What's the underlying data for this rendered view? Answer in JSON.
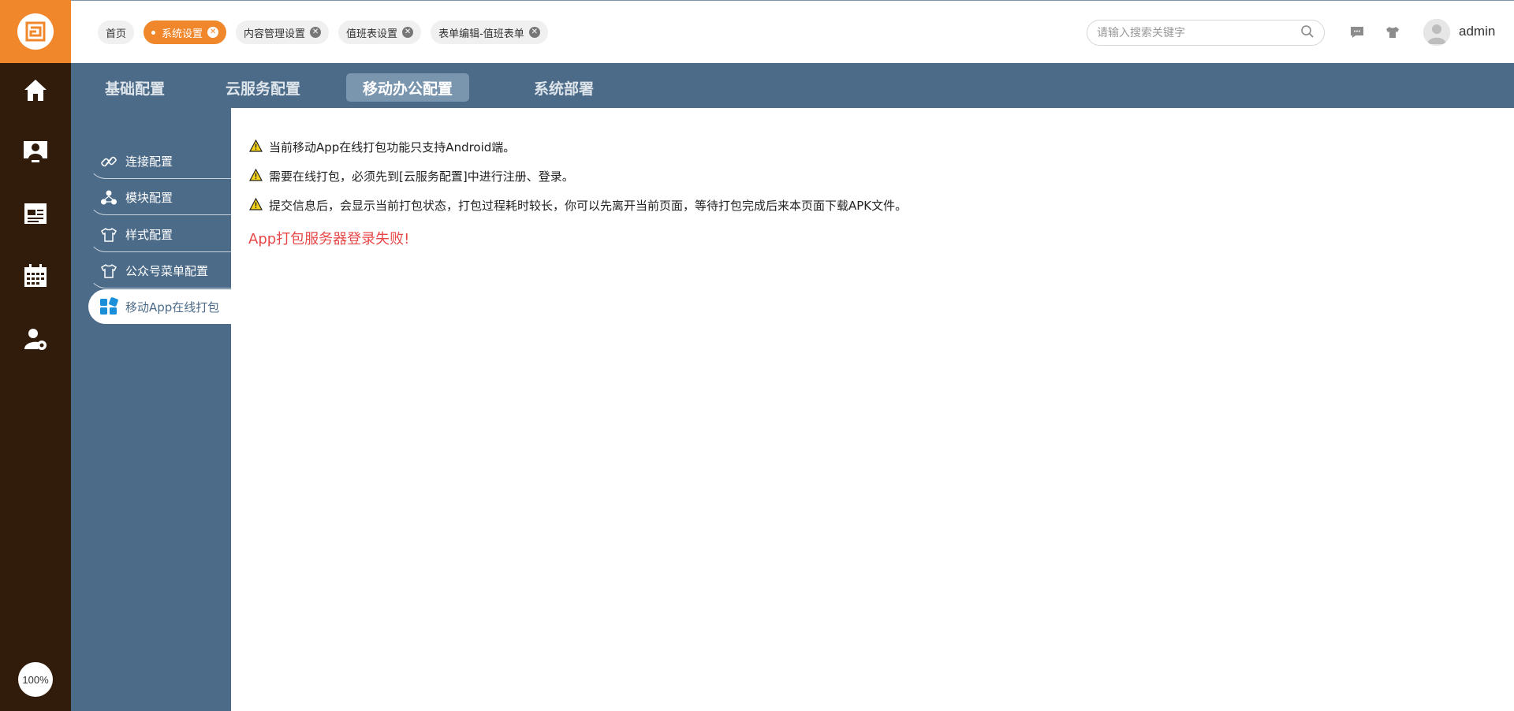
{
  "rail": {
    "icons": [
      "home-icon",
      "user-monitor-icon",
      "newspaper-icon",
      "calendar-icon",
      "user-settings-icon"
    ],
    "zoom": "100%"
  },
  "tags": [
    {
      "label": "首页",
      "closable": false,
      "active": false
    },
    {
      "label": "系统设置",
      "closable": true,
      "active": true
    },
    {
      "label": "内容管理设置",
      "closable": true,
      "active": false
    },
    {
      "label": "值班表设置",
      "closable": true,
      "active": false
    },
    {
      "label": "表单编辑-值班表单",
      "closable": true,
      "active": false
    }
  ],
  "search": {
    "placeholder": "请输入搜索关键字"
  },
  "user": {
    "name": "admin"
  },
  "subnav": {
    "tabs": [
      "基础配置",
      "云服务配置",
      "移动办公配置",
      "系统部署"
    ],
    "active_index": 2
  },
  "sidemenu": {
    "items": [
      {
        "label": "连接配置",
        "icon": "link-icon"
      },
      {
        "label": "模块配置",
        "icon": "modules-icon"
      },
      {
        "label": "样式配置",
        "icon": "shirt-icon"
      },
      {
        "label": "公众号菜单配置",
        "icon": "shirt-icon"
      },
      {
        "label": "移动App在线打包",
        "icon": "apps-grid-icon"
      }
    ],
    "active_index": 4
  },
  "content": {
    "notices": [
      "当前移动App在线打包功能只支持Android端。",
      "需要在线打包，必须先到[云服务配置]中进行注册、登录。",
      "提交信息后，会显示当前打包状态，打包过程耗时较长，你可以先离开当前页面，等待打包完成后来本页面下载APK文件。"
    ],
    "error": "App打包服务器登录失败!"
  },
  "colors": {
    "accent": "#f0872b",
    "rail": "#311c0b",
    "nav": "#4c6b89",
    "nav_active": "#7a95ae",
    "error": "#e84848"
  }
}
